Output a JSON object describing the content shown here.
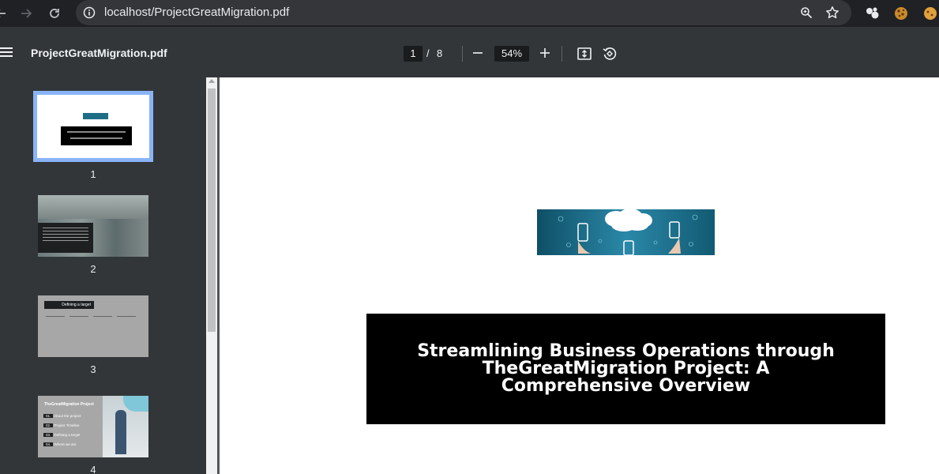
{
  "browser": {
    "url": "localhost/ProjectGreatMigration.pdf"
  },
  "toolbar": {
    "title": "ProjectGreatMigration.pdf",
    "current_page": "1",
    "page_separator": "/",
    "total_pages": "8",
    "zoom": "54%"
  },
  "thumbnails": [
    {
      "number": "1",
      "selected": true
    },
    {
      "number": "2",
      "selected": false
    },
    {
      "number": "3",
      "selected": false
    },
    {
      "number": "4",
      "selected": false
    }
  ],
  "thumb3": {
    "heading": "Defining a target"
  },
  "thumb4": {
    "heading": "TheGreatMigration Project",
    "items": [
      {
        "num": "01.",
        "label": "About the project"
      },
      {
        "num": "02.",
        "label": "Project Timeline"
      },
      {
        "num": "03.",
        "label": "Defining a target"
      },
      {
        "num": "04.",
        "label": "Where we are"
      }
    ]
  },
  "page1": {
    "title": "Streamlining Business Operations through TheGreatMigration Project: A Comprehensive Overview"
  },
  "colors": {
    "selection": "#8ab4f8",
    "toolbar": "#323639",
    "title_box": "#000000"
  }
}
